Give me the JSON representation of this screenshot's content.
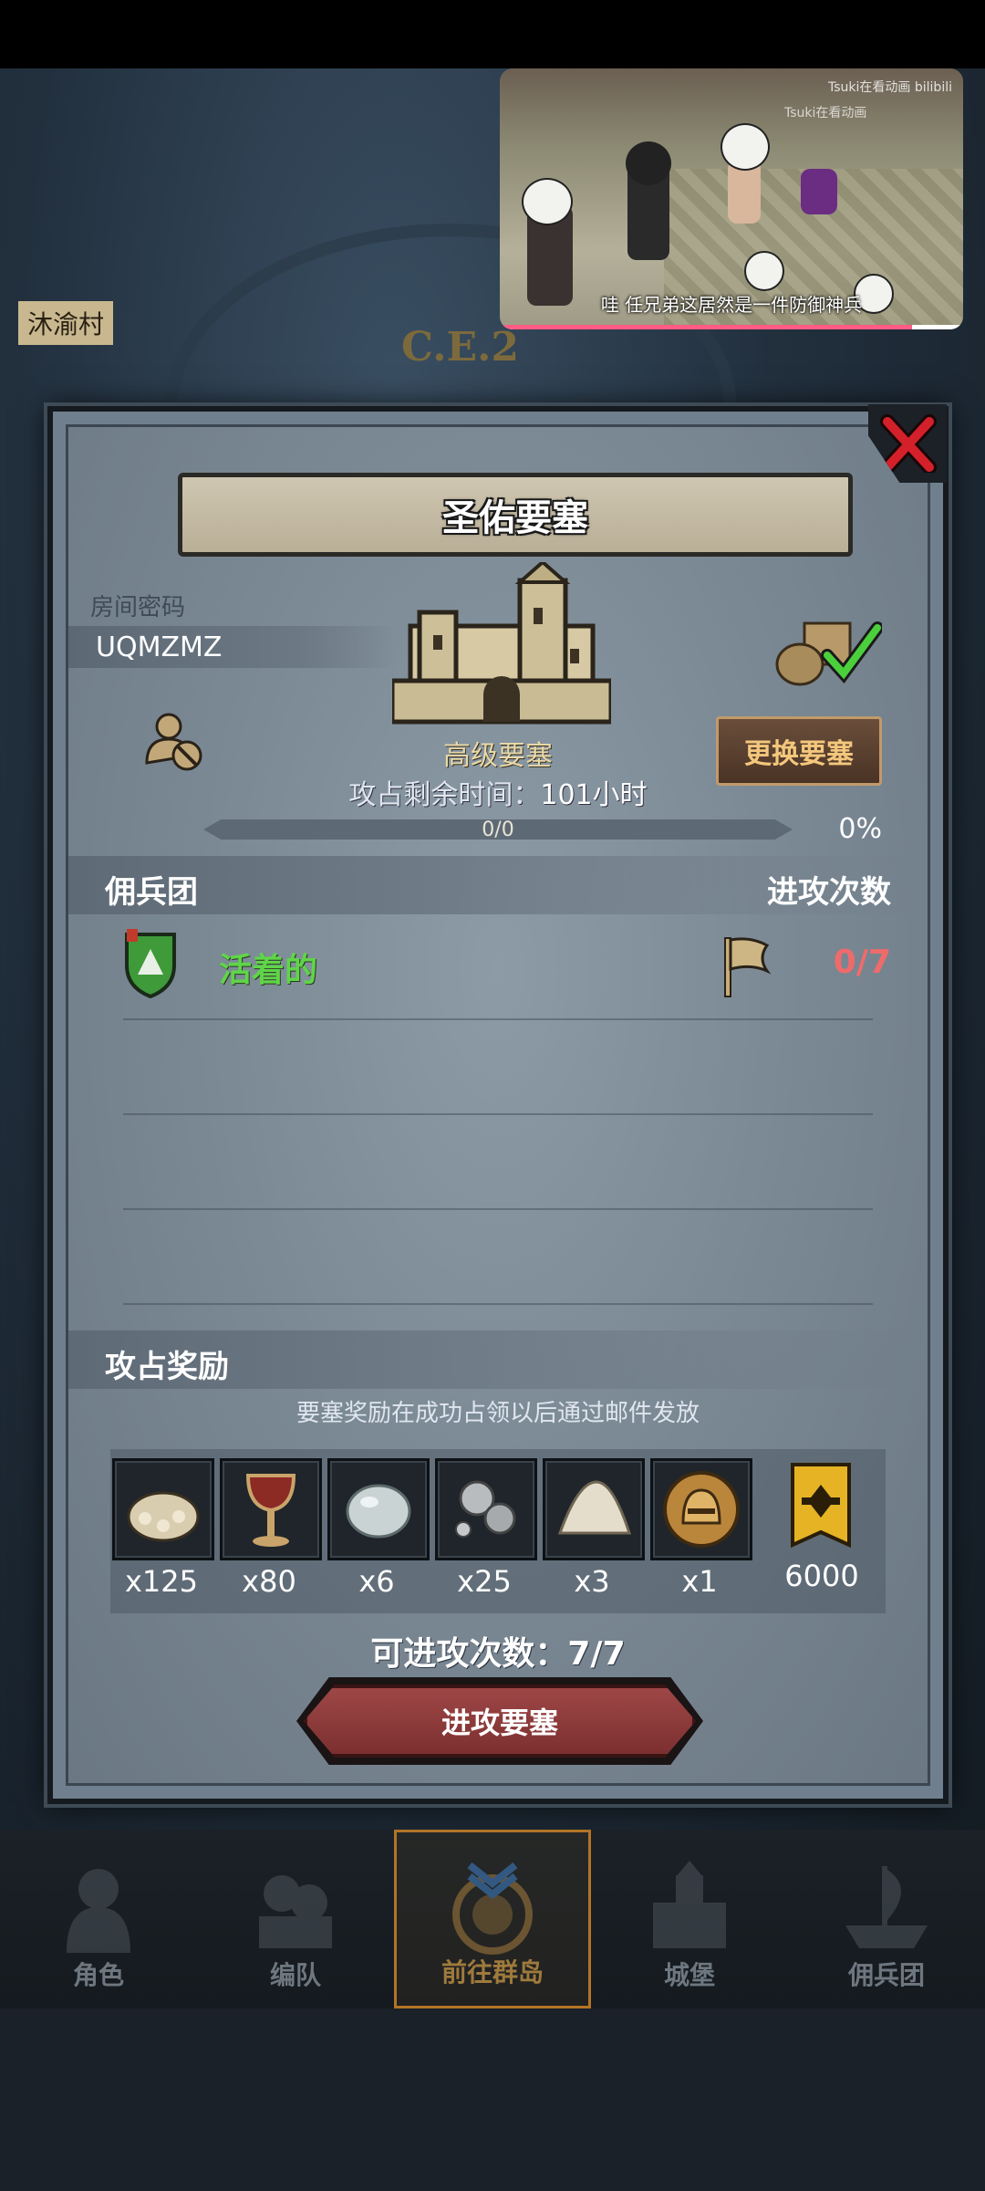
{
  "video_overlay": {
    "subtitle": "哇 任兄弟这居然是一件防御神兵",
    "watermark": "Tsuki在看动画 bilibili",
    "watermark2": "Tsuki在看动画",
    "progress_fraction": 0.89
  },
  "background": {
    "village_label": "沐渝村",
    "ce_label": "C.E.2"
  },
  "dialog": {
    "title": "圣佑要塞",
    "room_password_label": "房间密码",
    "room_password": "UQMZMZ",
    "fort_grade": "高级要塞",
    "switch_fort_button": "更换要塞",
    "occupy_time_label": "攻占剩余时间：",
    "occupy_time_value": "101",
    "occupy_time_unit": "小时",
    "progress_text": "0/0",
    "progress_percent": "0%",
    "progress_fraction": 0,
    "mercenary_header": "佣兵团",
    "attack_count_header": "进攻次数",
    "mercenaries": [
      {
        "name": "活着的",
        "attacks": "0/7"
      }
    ],
    "rewards_header": "攻占奖励",
    "rewards_note": "要塞奖励在成功占领以后通过邮件发放",
    "rewards": [
      {
        "icon": "coin-sack-icon",
        "count": "x125"
      },
      {
        "icon": "goblet-icon",
        "count": "x80"
      },
      {
        "icon": "egg-stone-icon",
        "count": "x6"
      },
      {
        "icon": "silver-ore-icon",
        "count": "x25"
      },
      {
        "icon": "salt-pile-icon",
        "count": "x3"
      },
      {
        "icon": "golden-helmet-icon",
        "count": "x1"
      },
      {
        "icon": "guild-banner-icon",
        "count": "6000"
      }
    ],
    "remaining_attempts_label": "可进攻次数：",
    "remaining_attempts_value": "7/7",
    "attack_button": "进攻要塞"
  },
  "bottom_nav": {
    "items": [
      {
        "label": "角色",
        "icon": "knight-icon"
      },
      {
        "label": "编队",
        "icon": "formation-icon"
      },
      {
        "label": "前往群岛",
        "icon": "compass-icon",
        "active": true
      },
      {
        "label": "城堡",
        "icon": "castle-icon"
      },
      {
        "label": "佣兵团",
        "icon": "ship-icon"
      }
    ]
  },
  "colors": {
    "merc_name": "#5fd548",
    "attack_count": "#ef6b6b",
    "switch_btn_text": "#f3c77c",
    "attack_btn": "#8a3838"
  }
}
